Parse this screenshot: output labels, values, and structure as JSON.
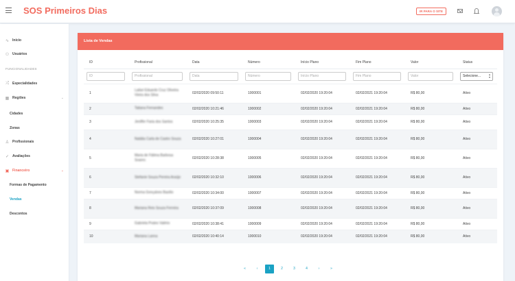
{
  "header": {
    "brand": "SOS Primeiros Dias",
    "site_button": "IR PARA O SITE"
  },
  "sidebar": {
    "items": [
      {
        "label": "Início",
        "icon": "pulse-icon"
      },
      {
        "label": "Usuários",
        "icon": "users-icon"
      }
    ],
    "section_label": "FUNCIONALIDADES",
    "especialidades": "Especialidades",
    "regioes": "Regiões",
    "cidades": "Cidades",
    "zonas": "Zonas",
    "profissionais": "Profissionais",
    "avaliacoes": "Avaliações",
    "financeiro": "Financeiro",
    "formas_pagamento": "Formas de Pagamento",
    "vendas": "Vendas",
    "descontos": "Descontos"
  },
  "card": {
    "title": "Lista de Vendas"
  },
  "table": {
    "columns": [
      "ID",
      "Profissional",
      "Data",
      "Número",
      "Início Plano",
      "Fim Plano",
      "Valor",
      "Status"
    ],
    "filters": [
      "ID",
      "Profissional",
      "Data",
      "Número",
      "Início Plano",
      "Fim Plano",
      "Valor"
    ],
    "status_filter": "Selecione...",
    "rows": [
      {
        "id": "1",
        "profissional": "Lailari Eduardo Cruz Oliveira Vieira dos Silva",
        "data": "02/02/2020 09:50:11",
        "numero": "1000001",
        "inicio": "02/02/2020 19:20:04",
        "fim": "02/02/2021 19:20:04",
        "valor": "R$ 80,00",
        "status": "Ativo"
      },
      {
        "id": "2",
        "profissional": "Tatiana Fernandes",
        "data": "02/02/2020 10:21:46",
        "numero": "1000002",
        "inicio": "02/02/2020 19:20:04",
        "fim": "02/02/2021 19:20:04",
        "valor": "R$ 80,00",
        "status": "Ativo"
      },
      {
        "id": "3",
        "profissional": "Jeniffer Faria dos Santos",
        "data": "02/02/2020 10:25:35",
        "numero": "1000003",
        "inicio": "02/02/2020 19:20:04",
        "fim": "02/02/2021 19:20:04",
        "valor": "R$ 80,00",
        "status": "Ativo"
      },
      {
        "id": "4",
        "profissional": "Natália Carla de Castro Souza",
        "data": "02/02/2020 10:27:01",
        "numero": "1000004",
        "inicio": "02/02/2020 19:20:04",
        "fim": "02/02/2021 19:20:04",
        "valor": "R$ 80,00",
        "status": "Ativo"
      },
      {
        "id": "5",
        "profissional": "Maria de Fátima Barbosa Soares",
        "data": "02/02/2020 10:28:38",
        "numero": "1000005",
        "inicio": "02/02/2020 19:20:04",
        "fim": "02/02/2021 19:20:04",
        "valor": "R$ 80,00",
        "status": "Ativo"
      },
      {
        "id": "6",
        "profissional": "Stefanie Souza Pereira Araújo",
        "data": "02/02/2020 10:32:10",
        "numero": "1000006",
        "inicio": "02/02/2020 19:20:04",
        "fim": "02/02/2021 19:20:04",
        "valor": "R$ 80,00",
        "status": "Ativo"
      },
      {
        "id": "7",
        "profissional": "Norma Gonçalves Basílio",
        "data": "02/02/2020 10:34:00",
        "numero": "1000007",
        "inicio": "02/02/2020 19:20:04",
        "fim": "02/02/2021 19:20:04",
        "valor": "R$ 80,00",
        "status": "Ativo"
      },
      {
        "id": "8",
        "profissional": "Mariana Reis Souza Ferreira",
        "data": "02/02/2020 10:37:09",
        "numero": "1000008",
        "inicio": "02/02/2020 19:20:04",
        "fim": "02/02/2021 19:20:04",
        "valor": "R$ 80,00",
        "status": "Ativo"
      },
      {
        "id": "9",
        "profissional": "Gabriela Prates Valério",
        "data": "02/02/2020 10:38:41",
        "numero": "1000009",
        "inicio": "02/02/2020 19:20:04",
        "fim": "02/02/2021 19:20:04",
        "valor": "R$ 80,00",
        "status": "Ativo"
      },
      {
        "id": "10",
        "profissional": "Mariana Lanna",
        "data": "02/02/2020 10:40:14",
        "numero": "1000010",
        "inicio": "02/02/2020 19:20:04",
        "fim": "02/02/2021 19:20:04",
        "valor": "R$ 80,00",
        "status": "Ativo"
      }
    ]
  },
  "pagination": {
    "first": "«",
    "prev": "‹",
    "pages": [
      "1",
      "2",
      "3",
      "4"
    ],
    "next": "›",
    "last": "»",
    "current": "1"
  },
  "colors": {
    "accent": "#f26b5e",
    "link": "#1aa2c4"
  }
}
